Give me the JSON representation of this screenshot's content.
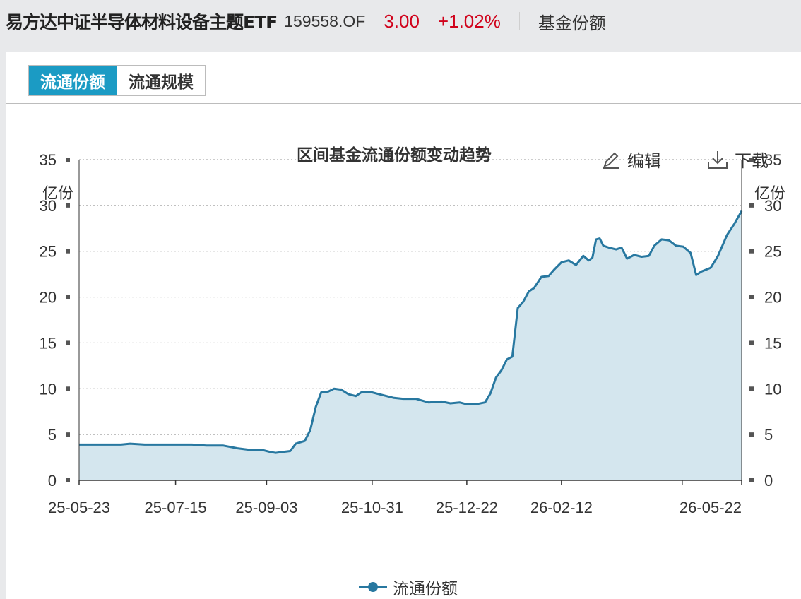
{
  "header": {
    "fund_name": "易方达中证半导体材料设备主题ETF",
    "fund_code": "159558.OF",
    "price": "3.00",
    "change": "+1.02%",
    "nav_label": "基金份额"
  },
  "tabs": [
    {
      "label": "流通份额",
      "active": true
    },
    {
      "label": "流通规模",
      "active": false
    }
  ],
  "toolbar": {
    "edit_label": "编辑",
    "download_label": "下载"
  },
  "colors": {
    "line": "#2878a0",
    "area": "#d4e6ee",
    "up": "#d0021b",
    "tab_active": "#1b9bc4"
  },
  "chart_data": {
    "type": "area",
    "title": "区间基金流通份额变动趋势",
    "y_unit_left": "亿份",
    "y_unit_right": "亿份",
    "ylim": [
      0,
      35
    ],
    "yticks": [
      0,
      5,
      10,
      15,
      20,
      25,
      30,
      35
    ],
    "grid": true,
    "x_tick_labels": [
      "25-05-23",
      "25-07-15",
      "25-09-03",
      "25-10-31",
      "25-12-22",
      "26-02-12",
      "26-05-22"
    ],
    "legend_position": "bottom",
    "series": [
      {
        "name": "流通份额",
        "points": [
          [
            "25-05-23",
            3.9
          ],
          [
            "25-06-01",
            3.9
          ],
          [
            "25-06-09",
            3.9
          ],
          [
            "25-06-15",
            3.9
          ],
          [
            "25-06-20",
            4.0
          ],
          [
            "25-06-28",
            3.9
          ],
          [
            "25-07-07",
            3.9
          ],
          [
            "25-07-15",
            3.9
          ],
          [
            "25-07-24",
            3.9
          ],
          [
            "25-08-01",
            3.8
          ],
          [
            "25-08-10",
            3.8
          ],
          [
            "25-08-18",
            3.5
          ],
          [
            "25-08-26",
            3.3
          ],
          [
            "25-09-01",
            3.3
          ],
          [
            "25-09-05",
            3.1
          ],
          [
            "25-09-08",
            3.0
          ],
          [
            "25-09-12",
            3.1
          ],
          [
            "25-09-16",
            3.2
          ],
          [
            "25-09-19",
            4.0
          ],
          [
            "25-09-24",
            4.3
          ],
          [
            "25-09-27",
            5.5
          ],
          [
            "25-09-30",
            8.0
          ],
          [
            "25-10-03",
            9.6
          ],
          [
            "25-10-07",
            9.7
          ],
          [
            "25-10-10",
            10.0
          ],
          [
            "25-10-14",
            9.9
          ],
          [
            "25-10-18",
            9.4
          ],
          [
            "25-10-22",
            9.2
          ],
          [
            "25-10-25",
            9.6
          ],
          [
            "25-10-31",
            9.6
          ],
          [
            "25-11-06",
            9.3
          ],
          [
            "25-11-12",
            9.0
          ],
          [
            "25-11-17",
            8.9
          ],
          [
            "25-11-24",
            8.9
          ],
          [
            "25-12-01",
            8.5
          ],
          [
            "25-12-08",
            8.6
          ],
          [
            "25-12-13",
            8.4
          ],
          [
            "25-12-18",
            8.5
          ],
          [
            "25-12-22",
            8.3
          ],
          [
            "25-12-27",
            8.3
          ],
          [
            "26-01-01",
            8.5
          ],
          [
            "26-01-04",
            9.5
          ],
          [
            "26-01-07",
            11.2
          ],
          [
            "26-01-10",
            12.0
          ],
          [
            "26-01-13",
            13.2
          ],
          [
            "26-01-16",
            13.5
          ],
          [
            "26-01-19",
            18.8
          ],
          [
            "26-01-22",
            19.5
          ],
          [
            "26-01-25",
            20.6
          ],
          [
            "26-01-28",
            21.0
          ],
          [
            "26-02-01",
            22.2
          ],
          [
            "26-02-05",
            22.3
          ],
          [
            "26-02-08",
            23.0
          ],
          [
            "26-02-12",
            23.8
          ],
          [
            "26-02-16",
            24.0
          ],
          [
            "26-02-20",
            23.5
          ],
          [
            "26-02-24",
            24.5
          ],
          [
            "26-02-27",
            24.0
          ],
          [
            "26-03-01",
            24.3
          ],
          [
            "26-03-03",
            26.3
          ],
          [
            "26-03-05",
            26.4
          ],
          [
            "26-03-07",
            25.6
          ],
          [
            "26-03-10",
            25.4
          ],
          [
            "26-03-14",
            25.2
          ],
          [
            "26-03-17",
            25.4
          ],
          [
            "26-03-20",
            24.2
          ],
          [
            "26-03-24",
            24.6
          ],
          [
            "26-03-28",
            24.4
          ],
          [
            "26-04-01",
            24.5
          ],
          [
            "26-04-04",
            25.6
          ],
          [
            "26-04-08",
            26.3
          ],
          [
            "26-04-12",
            26.2
          ],
          [
            "26-04-16",
            25.6
          ],
          [
            "26-04-20",
            25.5
          ],
          [
            "26-04-24",
            24.8
          ],
          [
            "26-04-27",
            22.4
          ],
          [
            "26-04-30",
            22.8
          ],
          [
            "26-05-05",
            23.2
          ],
          [
            "26-05-09",
            24.5
          ],
          [
            "26-05-14",
            26.8
          ],
          [
            "26-05-18",
            28.0
          ],
          [
            "26-05-22",
            29.4
          ]
        ]
      }
    ]
  }
}
